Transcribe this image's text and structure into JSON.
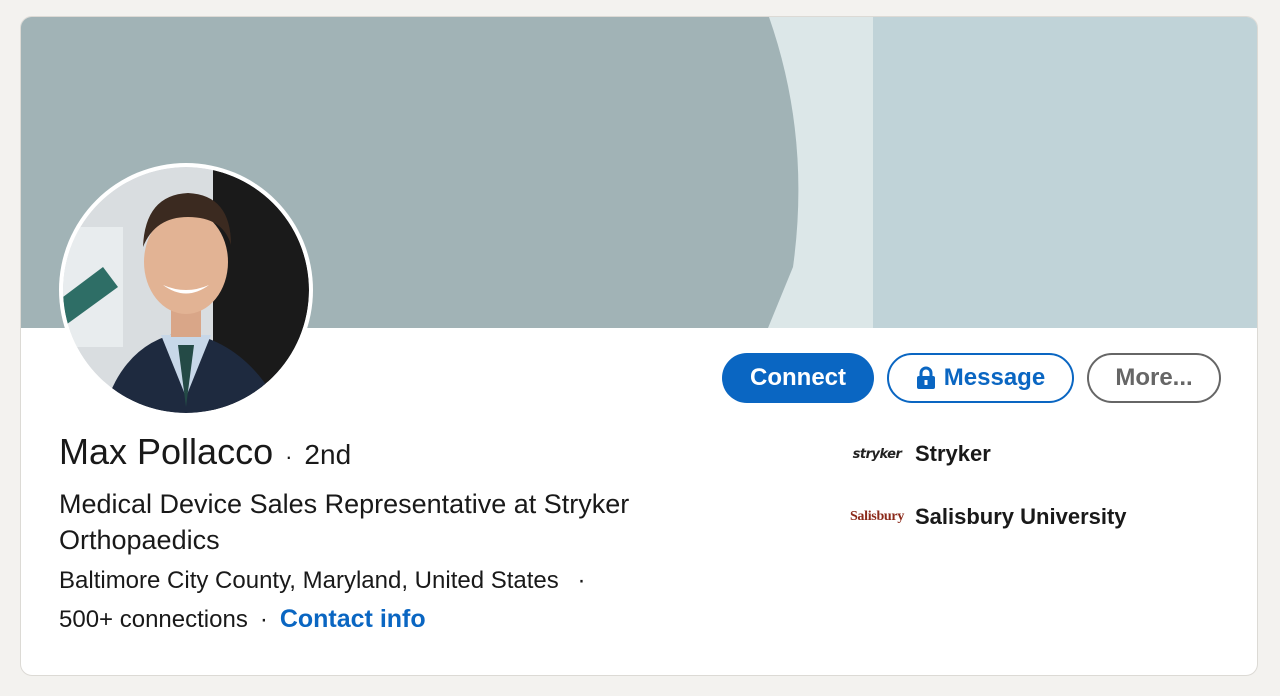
{
  "profile": {
    "name": "Max Pollacco",
    "separator": "·",
    "degree": "2nd",
    "headline": "Medical Device Sales Representative at Stryker Orthopaedics",
    "location": "Baltimore City County, Maryland, United States",
    "connections": "500+ connections",
    "contact_info_label": "Contact info"
  },
  "actions": {
    "connect_label": "Connect",
    "message_label": "Message",
    "more_label": "More..."
  },
  "organizations": [
    {
      "name": "Stryker",
      "logo_text": "stryker",
      "logo_icon": "stryker-logo"
    },
    {
      "name": "Salisbury University",
      "logo_text": "Salisbury",
      "logo_icon": "salisbury-logo"
    }
  ],
  "colors": {
    "accent": "#0a66c2",
    "banner_dark": "#a1b3b6",
    "banner_light": "#c0d3d8",
    "banner_strip": "#dce7e8",
    "page_bg": "#f3f2ef"
  }
}
